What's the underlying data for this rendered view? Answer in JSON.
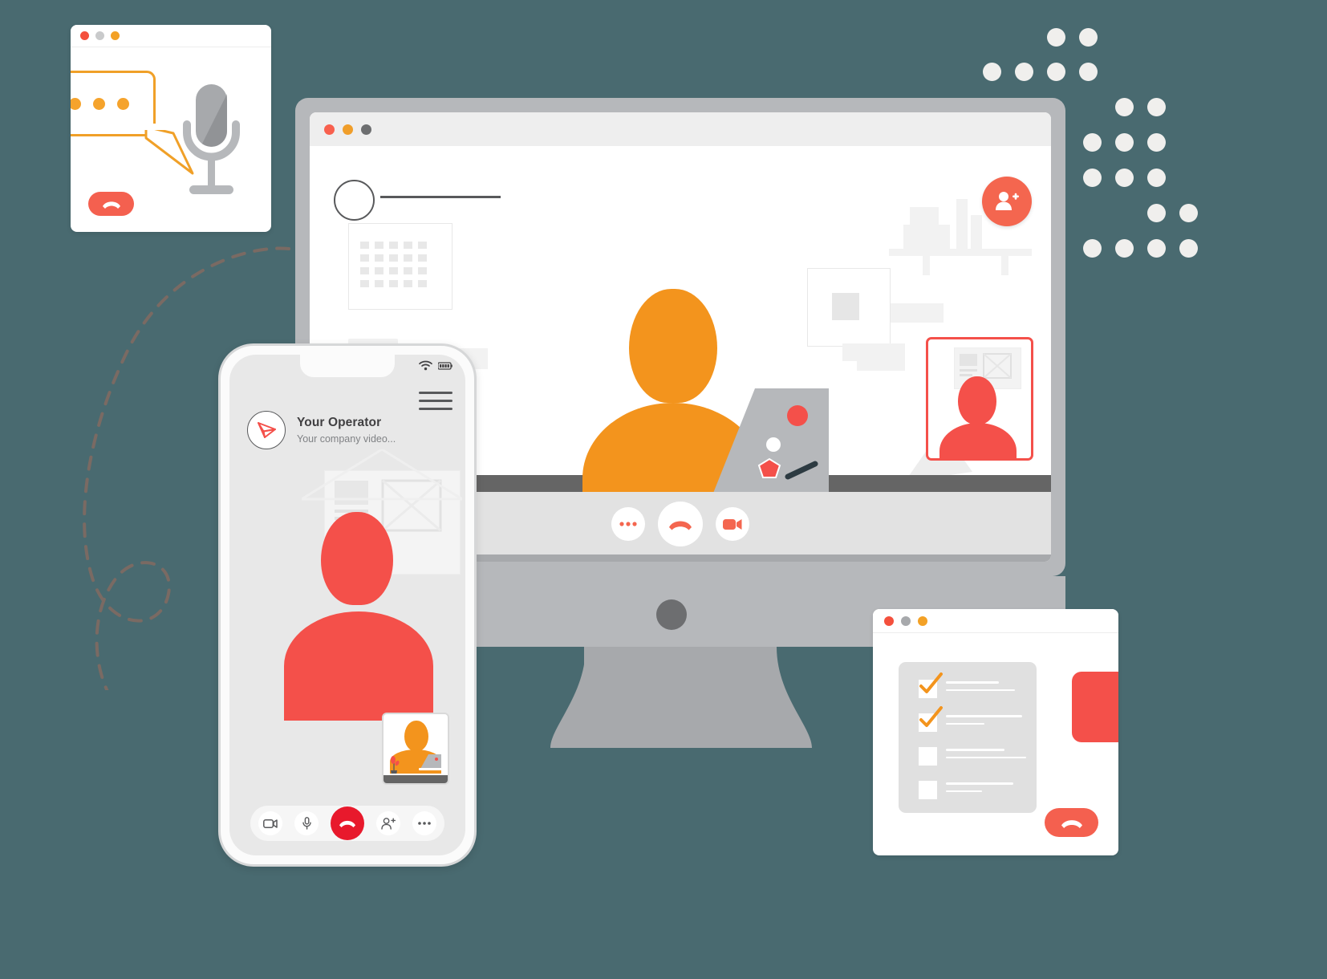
{
  "meta": {
    "background_color": "#496a70",
    "accent_red": "#f4504a",
    "accent_orange": "#f3941d",
    "accent_amber": "#f0a028",
    "grey": "#b6b8bb"
  },
  "chat_window": {
    "name": "chat-window",
    "traffic_lights": [
      "#f4503d",
      "#c9cacb",
      "#f3a126"
    ],
    "bubble_dots": 3,
    "icons": {
      "microphone": "microphone-icon",
      "hangup": "hangup-icon",
      "chat_bubble": "chat-bubble-icon"
    }
  },
  "monitor": {
    "name": "desktop-monitor",
    "traffic_lights": [
      "#f8604e",
      "#f09e2a",
      "#6d6e70"
    ],
    "header": {
      "avatar": "avatar-placeholder",
      "title_placeholder_line": true
    },
    "add_participant_button": {
      "icon": "add-person-icon",
      "color": "#f4664f"
    },
    "controls": [
      {
        "name": "more-options-button",
        "icon": "ellipsis-icon"
      },
      {
        "name": "end-call-button",
        "icon": "hangup-icon"
      },
      {
        "name": "toggle-video-button",
        "icon": "video-camera-icon"
      }
    ],
    "pip": {
      "name": "picture-in-picture",
      "border_color": "#f4504a"
    },
    "scene": {
      "person_color": "#f3941d",
      "laptop": true,
      "plant": true,
      "shelf": true
    }
  },
  "phone": {
    "name": "mobile-phone",
    "status_bar": {
      "wifi": "wifi-icon",
      "battery": "battery-icon"
    },
    "menu": "hamburger-menu-icon",
    "brand": {
      "logo": "paper-plane-icon",
      "title": "Your Operator",
      "subtitle": "Your company video..."
    },
    "caller_color": "#f4504a",
    "pip": {
      "name": "self-view-thumbnail",
      "person_color": "#f3941d"
    },
    "controls": [
      {
        "name": "toggle-video-button",
        "icon": "video-camera-icon"
      },
      {
        "name": "mute-button",
        "icon": "microphone-icon"
      },
      {
        "name": "end-call-button",
        "icon": "hangup-icon"
      },
      {
        "name": "add-participant-button",
        "icon": "add-person-icon"
      },
      {
        "name": "more-options-button",
        "icon": "ellipsis-icon"
      }
    ]
  },
  "checklist_window": {
    "name": "checklist-window",
    "traffic_lights": [
      "#f4503d",
      "#a7a9ac",
      "#f3a126"
    ],
    "items": [
      {
        "checked": true,
        "lines": [
          108,
          126
        ]
      },
      {
        "checked": true,
        "lines": [
          104,
          52
        ]
      },
      {
        "checked": false,
        "lines": [
          76,
          106
        ]
      },
      {
        "checked": false,
        "lines": [
          90,
          48
        ]
      }
    ],
    "camera_icon": "video-camera-icon",
    "hangup_icon": "hangup-icon"
  },
  "decor": {
    "dot_grid_color": "#f0efed",
    "dashed_path_color": "#7a6a63"
  }
}
